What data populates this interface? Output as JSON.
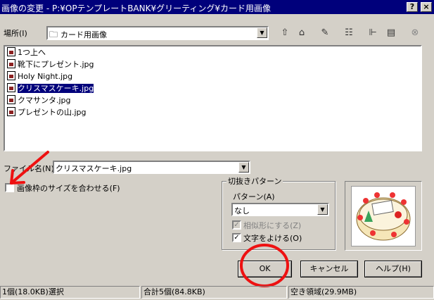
{
  "title": "画像の変更 - P:¥OPテンプレートBANK¥グリーティング¥カード用画像",
  "title_buttons": {
    "help": "?",
    "close": "×"
  },
  "location": {
    "label": "場所(I)",
    "value": "カード用画像"
  },
  "toolbar_icons": [
    "up-folder-icon",
    "desktop-icon",
    "new-folder-icon",
    "list-view-icon",
    "details-view-icon",
    "preview-icon",
    "disabled-icon"
  ],
  "files": [
    {
      "name": "1つ上へ",
      "icon": "up-arrow-icon",
      "selected": false
    },
    {
      "name": "靴下にプレゼント.jpg",
      "icon": "image-file-icon",
      "selected": false
    },
    {
      "name": "Holy Night.jpg",
      "icon": "image-file-icon",
      "selected": false
    },
    {
      "name": "クリスマスケーキ.jpg",
      "icon": "image-file-icon",
      "selected": true
    },
    {
      "name": "クマサンタ.jpg",
      "icon": "image-file-icon",
      "selected": false
    },
    {
      "name": "プレゼントの山.jpg",
      "icon": "image-file-icon",
      "selected": false
    }
  ],
  "filename": {
    "label": "ファイル名(N)",
    "value": "クリスマスケーキ.jpg"
  },
  "fit_checkbox": {
    "label": "画像枠のサイズを合わせる(F)",
    "checked": false
  },
  "crop_group": {
    "title": "切抜きパターン",
    "pattern_label": "パターン(A)",
    "pattern_value": "なし",
    "similar_label": "相似形にする(Z)",
    "similar_checked": true,
    "avoid_label": "文字をよける(O)",
    "avoid_checked": true
  },
  "buttons": {
    "ok": "OK",
    "cancel": "キャンセル",
    "help": "ヘルプ(H)"
  },
  "status": {
    "selected": "1個(18.0KB)選択",
    "total": "合計5個(84.8KB)",
    "free": "空き領域(29.9MB)"
  },
  "colors": {
    "title_bar": "#00007b",
    "annotation_red": "#ee1111"
  }
}
